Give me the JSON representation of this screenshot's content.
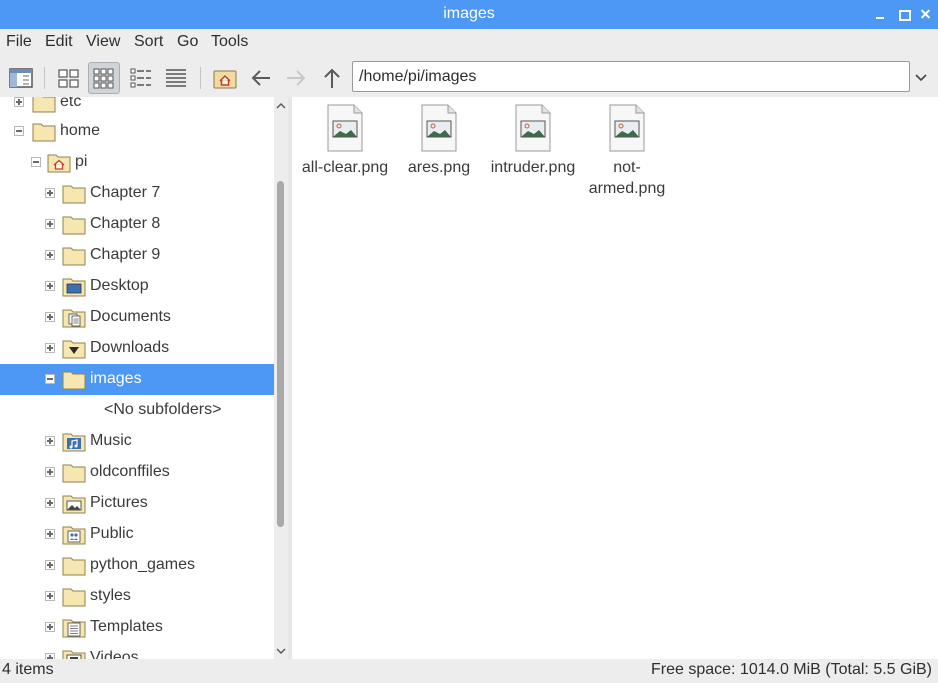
{
  "window": {
    "title": "images"
  },
  "menubar": {
    "items": [
      "File",
      "Edit",
      "View",
      "Sort",
      "Go",
      "Tools"
    ]
  },
  "toolbar": {
    "buttons": [
      "sidepane-toggle-icon",
      "icon-view-icon",
      "thumbnail-view-icon",
      "compact-view-icon",
      "list-view-icon",
      "home-icon",
      "back-arrow-icon",
      "forward-arrow-icon",
      "up-arrow-icon"
    ],
    "address": "/home/pi/images"
  },
  "tree": {
    "items": [
      {
        "label": "etc",
        "icon": "folder-icon",
        "expander": "plus"
      },
      {
        "label": "home",
        "icon": "folder-icon",
        "expander": "minus"
      },
      {
        "label": "pi",
        "icon": "home-folder-icon",
        "expander": "minus"
      },
      {
        "label": "Chapter 7",
        "icon": "folder-icon",
        "expander": "plus"
      },
      {
        "label": "Chapter 8",
        "icon": "folder-icon",
        "expander": "plus"
      },
      {
        "label": "Chapter 9",
        "icon": "folder-icon",
        "expander": "plus"
      },
      {
        "label": "Desktop",
        "icon": "desktop-folder-icon",
        "expander": "plus"
      },
      {
        "label": "Documents",
        "icon": "documents-folder-icon",
        "expander": "plus"
      },
      {
        "label": "Downloads",
        "icon": "downloads-folder-icon",
        "expander": "plus"
      },
      {
        "label": "images",
        "icon": "folder-icon",
        "expander": "minus",
        "selected": true
      },
      {
        "label": "<No subfolders>",
        "icon": "",
        "expander": ""
      },
      {
        "label": "Music",
        "icon": "music-folder-icon",
        "expander": "plus"
      },
      {
        "label": "oldconffiles",
        "icon": "folder-icon",
        "expander": "plus"
      },
      {
        "label": "Pictures",
        "icon": "pictures-folder-icon",
        "expander": "plus"
      },
      {
        "label": "Public",
        "icon": "public-folder-icon",
        "expander": "plus"
      },
      {
        "label": "python_games",
        "icon": "folder-icon",
        "expander": "plus"
      },
      {
        "label": "styles",
        "icon": "folder-icon",
        "expander": "plus"
      },
      {
        "label": "Templates",
        "icon": "templates-folder-icon",
        "expander": "plus"
      },
      {
        "label": "Videos",
        "icon": "videos-folder-icon",
        "expander": "plus"
      }
    ]
  },
  "files": [
    {
      "name": "all-clear.png"
    },
    {
      "name": "ares.png"
    },
    {
      "name": "intruder.png"
    },
    {
      "name": "not-\narmed.png"
    }
  ],
  "status": {
    "count": "4 items",
    "free_space": "Free space: 1014.0 MiB (Total: 5.5 GiB)"
  },
  "colors": {
    "accent": "#4d98f5",
    "folder": "#f6e6b0"
  }
}
